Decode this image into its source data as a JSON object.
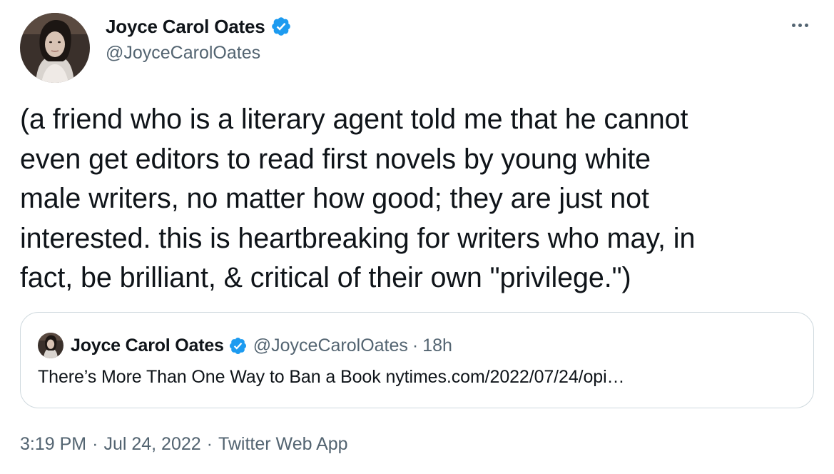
{
  "author": {
    "display_name": "Joyce Carol Oates",
    "handle": "@JoyceCarolOates",
    "verified": true,
    "avatar_icon": "profile-photo"
  },
  "more_icon": "ellipsis-icon",
  "tweet_text": "(a friend who is a literary agent told me that he cannot\neven get editors to read first novels by young white\nmale writers, no matter how good; they are just not\ninterested. this is heartbreaking for writers who may, in\nfact, be brilliant, & critical of their own \"privilege.\")",
  "quoted_tweet": {
    "display_name": "Joyce Carol Oates",
    "handle": "@JoyceCarolOates",
    "separator": "·",
    "time": "18h",
    "text": "There’s More Than One Way to Ban a Book nytimes.com/2022/07/24/opi…"
  },
  "meta": {
    "time": "3:19 PM",
    "separator": "·",
    "date": "Jul 24, 2022",
    "source": "Twitter Web App"
  },
  "colors": {
    "text_primary": "#0f1419",
    "text_secondary": "#536471",
    "verified_blue": "#1d9bf0",
    "border": "#cfd9de"
  }
}
